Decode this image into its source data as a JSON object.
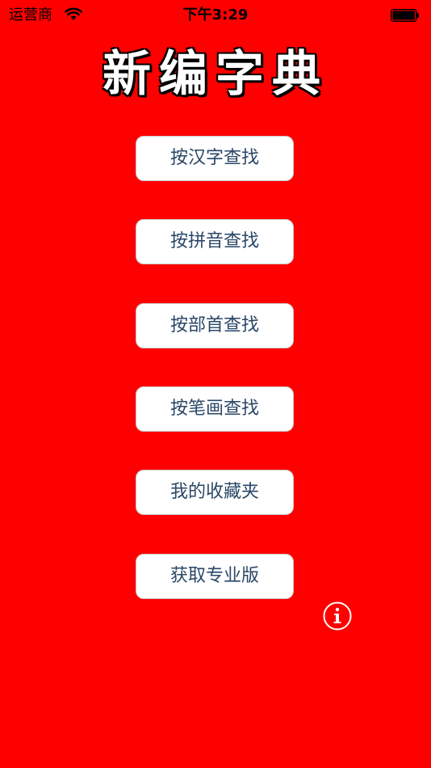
{
  "status_bar": {
    "carrier": "运营商",
    "time": "下午3:29",
    "icons": [
      "wifi-icon",
      "battery-icon"
    ]
  },
  "app": {
    "title": "新编字典"
  },
  "menu": {
    "buttons": [
      {
        "label": "按汉字查找"
      },
      {
        "label": "按拼音查找"
      },
      {
        "label": "按部首查找"
      },
      {
        "label": "按笔画查找"
      },
      {
        "label": "我的收藏夹"
      },
      {
        "label": "获取专业版"
      }
    ]
  },
  "info": {
    "icon": "info-icon"
  },
  "colors": {
    "background": "#ff0000",
    "button_text": "#2a4767",
    "button_bg": "#ffffff"
  }
}
